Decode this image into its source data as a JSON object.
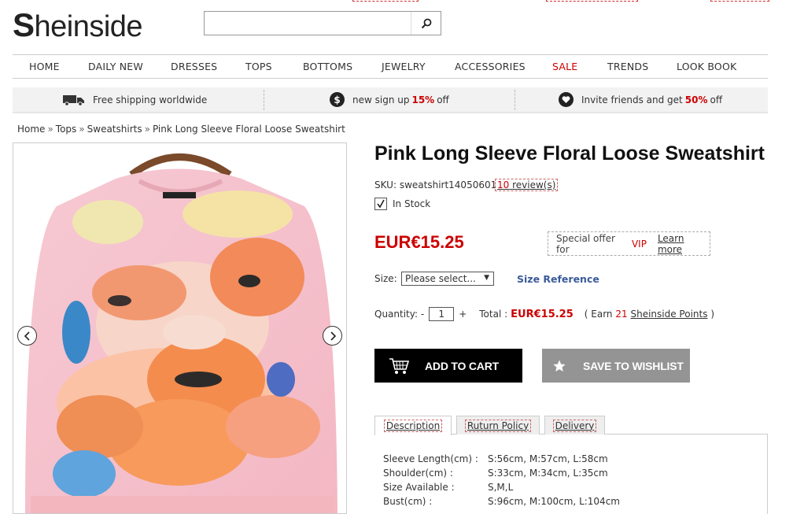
{
  "brand": {
    "logo_first": "S",
    "logo_rest": "heinside"
  },
  "search": {
    "placeholder": ""
  },
  "nav": [
    "HOME",
    "DAILY NEW",
    "DRESSES",
    "TOPS",
    "BOTTOMS",
    "JEWELRY",
    "ACCESSORIES",
    "SALE",
    "TRENDS",
    "LOOK BOOK"
  ],
  "promo": {
    "shipping": "Free shipping worldwide",
    "signup_pre": "new sign up",
    "signup_pct": "15%",
    "signup_post": "off",
    "invite_pre": "Invite friends and get",
    "invite_pct": "50%",
    "invite_post": "off"
  },
  "breadcrumb": {
    "home": "Home",
    "tops": "Tops",
    "sweatshirts": "Sweatshirts",
    "current": "Pink Long Sleeve Floral Loose Sweatshirt",
    "sep": "»"
  },
  "product": {
    "title": "Pink Long Sleeve Floral Loose Sweatshirt",
    "sku_label": "SKU:",
    "sku": "sweatshirt14050601",
    "reviews_count": "10",
    "reviews_text": "review(s)",
    "stock": "In Stock",
    "price": "EUR€15.25",
    "vip_pre": "Special offer for",
    "vip_word": "VIP",
    "learn_more": "Learn more",
    "size_label": "Size:",
    "size_selected": "Please select...",
    "size_reference": "Size Reference",
    "qty_label": "Quantity:",
    "qty_minus": "-",
    "qty_value": "1",
    "qty_plus": "+",
    "total_label": "Total :",
    "total_value": "EUR€15.25",
    "earn_open": "( Earn",
    "earn_points": "21",
    "earn_link": "Sheinside Points",
    "earn_close": ")",
    "add_to_cart": "ADD TO CART",
    "save_wishlist": "SAVE TO WISHLIST"
  },
  "tabs": [
    "Description",
    "Ruturn Policy",
    "Delivery"
  ],
  "specs": [
    {
      "k": "Sleeve Length(cm) :",
      "v": "S:56cm, M:57cm, L:58cm"
    },
    {
      "k": "Shoulder(cm) :",
      "v": "S:33cm, M:34cm, L:35cm"
    },
    {
      "k": "Size Available :",
      "v": "S,M,L"
    },
    {
      "k": "Bust(cm) :",
      "v": "S:96cm, M:100cm, L:104cm"
    }
  ],
  "colors": {
    "accent_red": "#cc0000",
    "link_blue": "#3a5b9a",
    "cart_bg": "#000000",
    "wishlist_bg": "#949494"
  }
}
